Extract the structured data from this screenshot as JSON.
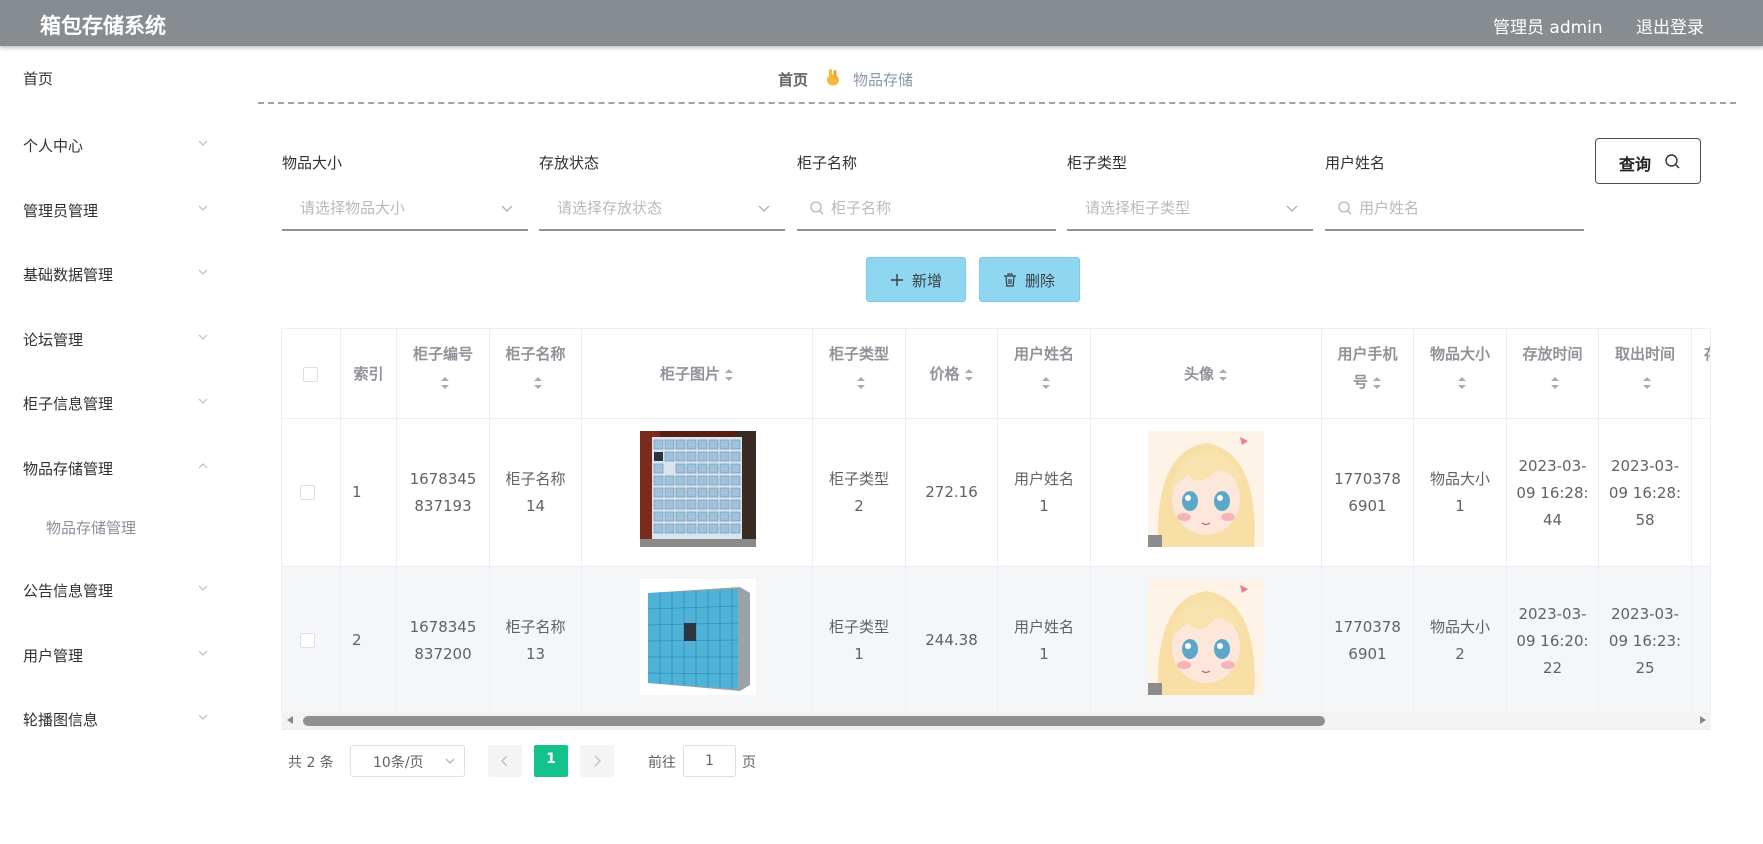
{
  "header": {
    "title": "箱包存储系统",
    "user": "管理员 admin",
    "logout": "退出登录"
  },
  "sidebar": {
    "home": "首页",
    "items": [
      {
        "label": "个人中心",
        "expanded": false
      },
      {
        "label": "管理员管理",
        "expanded": false
      },
      {
        "label": "基础数据管理",
        "expanded": false
      },
      {
        "label": "论坛管理",
        "expanded": false
      },
      {
        "label": "柜子信息管理",
        "expanded": false
      },
      {
        "label": "物品存储管理",
        "expanded": true
      },
      {
        "label": "公告信息管理",
        "expanded": false
      },
      {
        "label": "用户管理",
        "expanded": false
      },
      {
        "label": "轮播图信息",
        "expanded": false
      }
    ],
    "subitem": "物品存储管理"
  },
  "breadcrumb": {
    "home": "首页",
    "current": "物品存储"
  },
  "filters": {
    "size": {
      "label": "物品大小",
      "placeholder": "请选择物品大小"
    },
    "status": {
      "label": "存放状态",
      "placeholder": "请选择存放状态"
    },
    "cabinet_name": {
      "label": "柜子名称",
      "placeholder": "柜子名称"
    },
    "cabinet_type": {
      "label": "柜子类型",
      "placeholder": "请选择柜子类型"
    },
    "user_name": {
      "label": "用户姓名",
      "placeholder": "用户姓名"
    },
    "query": "查询"
  },
  "actions": {
    "add": "新增",
    "delete": "删除"
  },
  "table": {
    "headers": {
      "index": "索引",
      "code_1": "柜子编号",
      "name_1": "柜子名称",
      "image": "柜子图片",
      "type_1": "柜子类型",
      "price": "价格",
      "uname_1": "用户姓名",
      "avatar": "头像",
      "phone_1": "用户手机",
      "phone_2": "号",
      "size": "物品大小",
      "stime": "存放时间",
      "otime": "取出时间",
      "partial": "存"
    },
    "rows": [
      {
        "index": "1",
        "code": [
          "1678345",
          "837193"
        ],
        "name": [
          "柜子名称",
          "14"
        ],
        "type": [
          "柜子类型",
          "2"
        ],
        "price": "272.16",
        "uname": [
          "用户姓名",
          "1"
        ],
        "phone": [
          "1770378",
          "6901"
        ],
        "size": [
          "物品大小",
          "1"
        ],
        "stime": [
          "2023-03-",
          "09 16:28:",
          "44"
        ],
        "otime": [
          "2023-03-",
          "09 16:28:",
          "58"
        ]
      },
      {
        "index": "2",
        "code": [
          "1678345",
          "837200"
        ],
        "name": [
          "柜子名称",
          "13"
        ],
        "type": [
          "柜子类型",
          "1"
        ],
        "price": "244.38",
        "uname": [
          "用户姓名",
          "1"
        ],
        "phone": [
          "1770378",
          "6901"
        ],
        "size": [
          "物品大小",
          "2"
        ],
        "stime": [
          "2023-03-",
          "09 16:20:",
          "22"
        ],
        "otime": [
          "2023-03-",
          "09 16:23:",
          "25"
        ]
      }
    ]
  },
  "pagination": {
    "total": "共 2 条",
    "page_size": "10条/页",
    "current": "1",
    "goto_label": "前往",
    "goto_value": "1",
    "page_suffix": "页"
  },
  "colors": {
    "topbar": "#868c8f",
    "button_blue": "#8fd6f0",
    "page_active": "#13c28d"
  }
}
